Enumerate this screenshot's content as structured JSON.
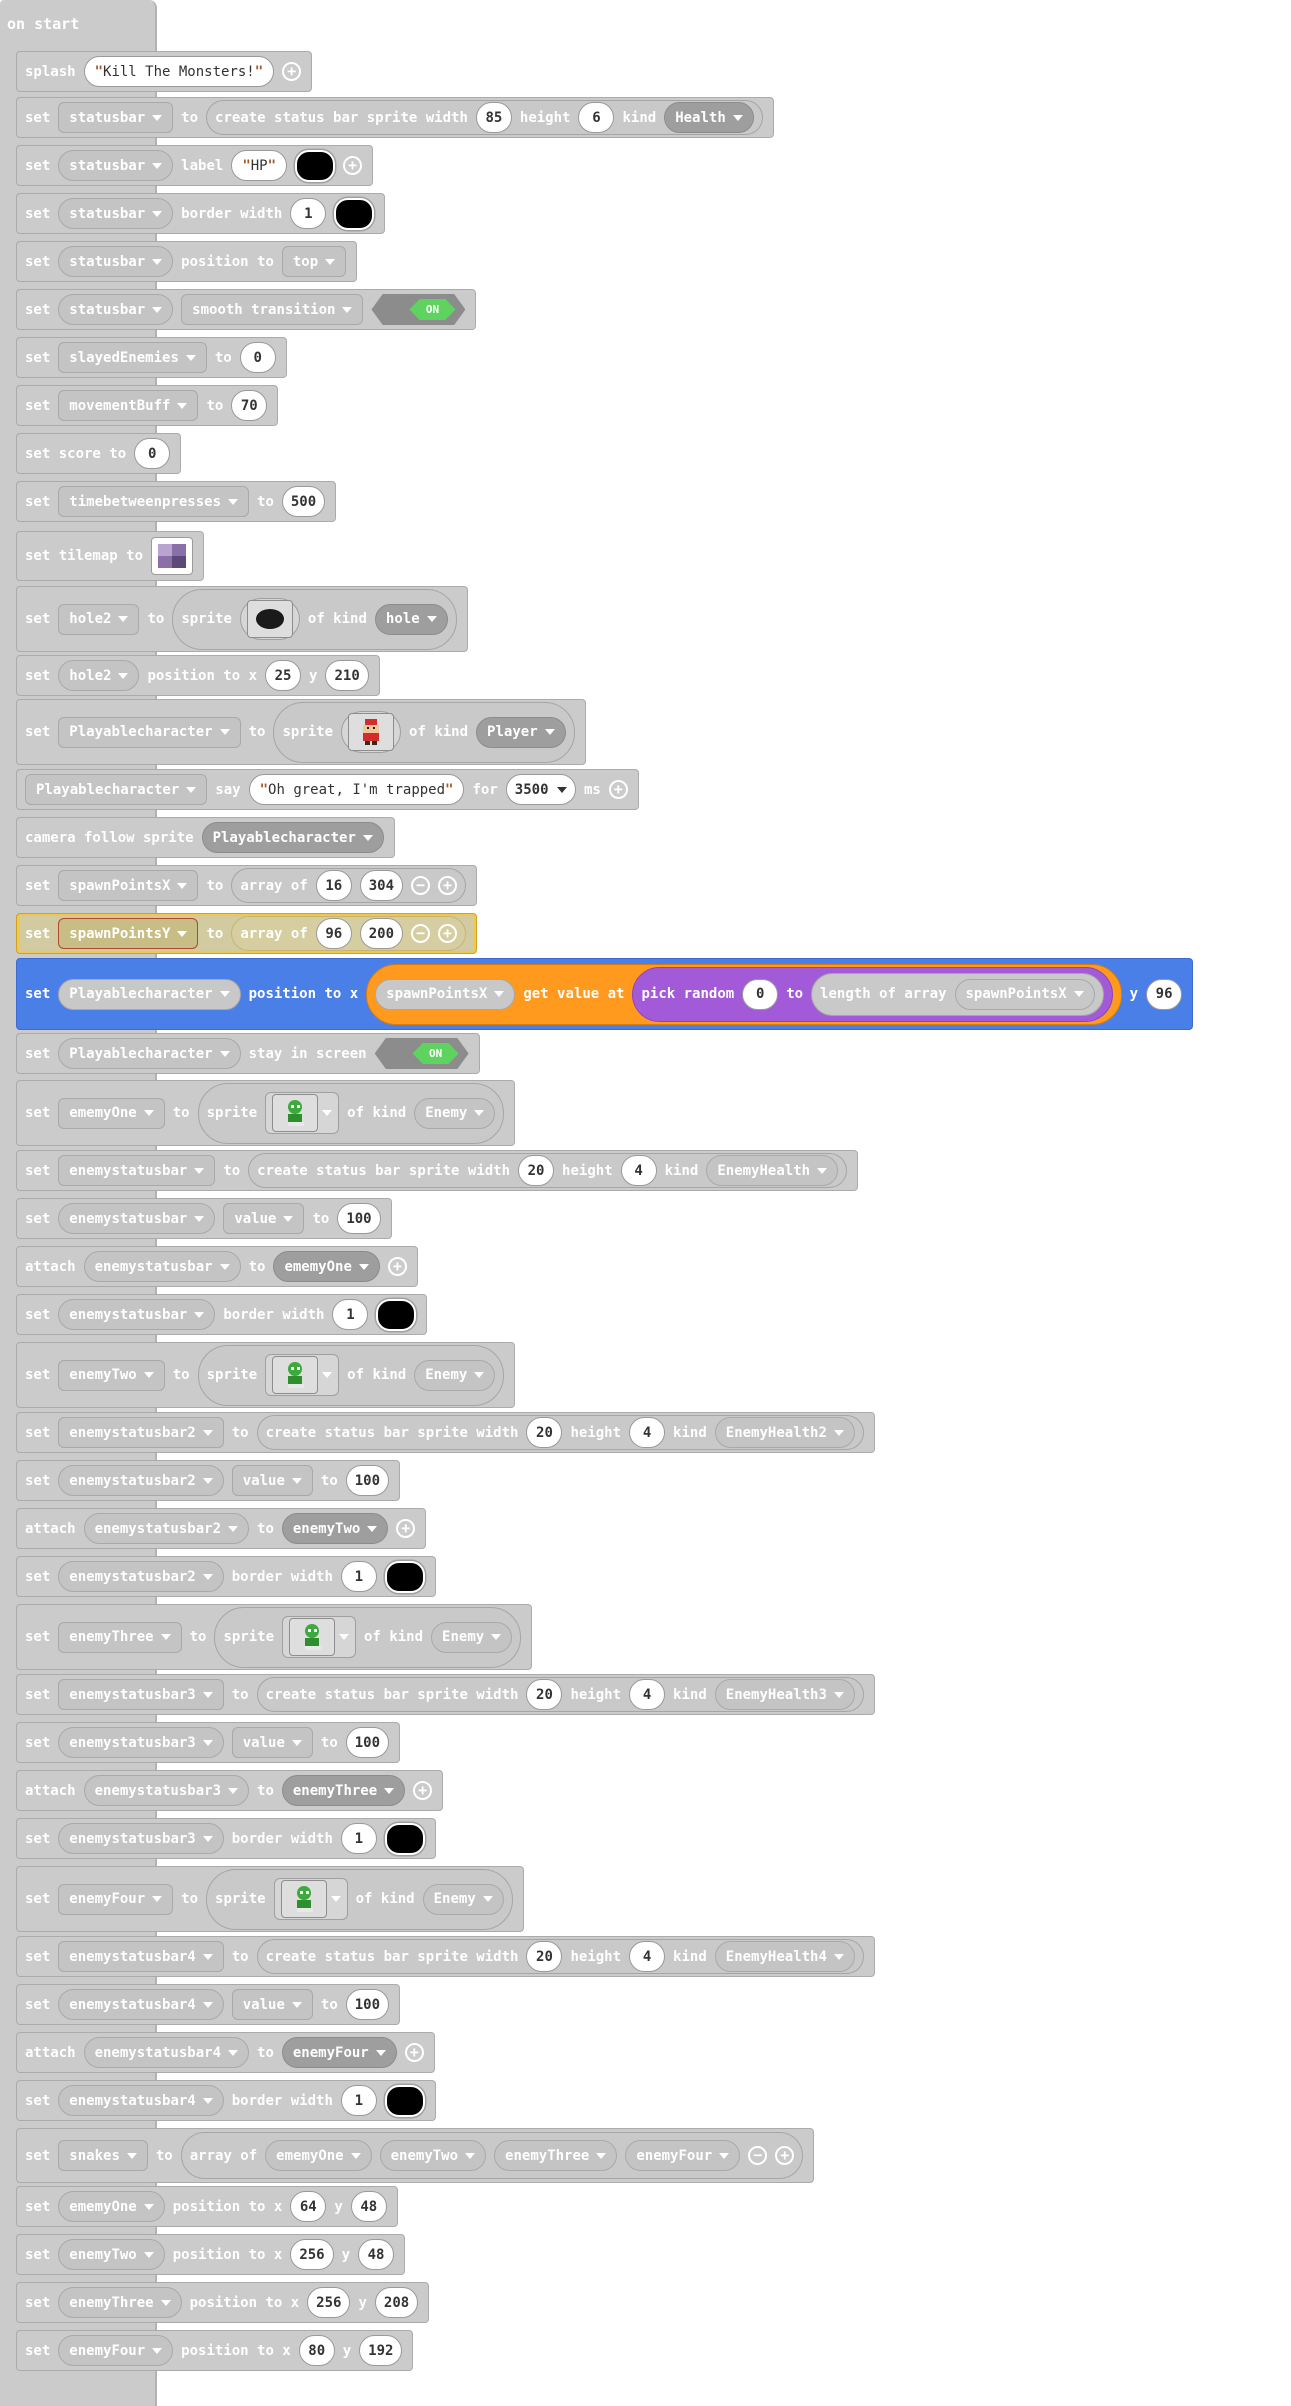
{
  "hat": "on start",
  "kw": {
    "set": "set",
    "to": "to",
    "splash": "splash",
    "label": "label",
    "border_width": "border width",
    "position_to": "position to",
    "of_kind": "of kind",
    "sprite": "sprite",
    "x": "x",
    "y": "y",
    "say": "say",
    "for": "for",
    "ms": "ms",
    "camera_follow": "camera follow sprite",
    "array_of": "array of",
    "get_value_at": "get value at",
    "pick_random": "pick random",
    "length_of_array": "length of array",
    "stay_in_screen": "stay in screen",
    "create_status": "create status bar sprite width",
    "height": "height",
    "kind": "kind",
    "attach": "attach",
    "set_score": "set score to",
    "set_tilemap": "set tilemap to",
    "position_to_x": "position to x",
    "on": "ON"
  },
  "vars": {
    "statusbar": "statusbar",
    "slayedEnemies": "slayedEnemies",
    "movementBuff": "movementBuff",
    "timebetweenpresses": "timebetweenpresses",
    "hole2": "hole2",
    "playable": "Playablecharacter",
    "spawnX": "spawnPointsX",
    "spawnY": "spawnPointsY",
    "emeyOne": "ememyOne",
    "enemyTwo": "enemyTwo",
    "enemyThree": "enemyThree",
    "enemyFour": "enemyFour",
    "esb": "enemystatusbar",
    "esb2": "enemystatusbar2",
    "esb3": "enemystatusbar3",
    "esb4": "enemystatusbar4",
    "snakes": "snakes"
  },
  "kinds": {
    "health": "Health",
    "hole": "hole",
    "player": "Player",
    "enemy": "Enemy",
    "eh": "EnemyHealth",
    "eh2": "EnemyHealth2",
    "eh3": "EnemyHealth3",
    "eh4": "EnemyHealth4"
  },
  "props": {
    "smooth": "smooth transition",
    "top": "top",
    "value": "value"
  },
  "strings": {
    "splash": "Kill The Monsters!",
    "hp": "HP",
    "say": "Oh great, I'm trapped",
    "quote_open": "\"",
    "quote_close": "\""
  },
  "nums": {
    "w85": "85",
    "h6": "6",
    "bw1": "1",
    "zero": "0",
    "mb": "70",
    "tbp": "500",
    "h2x": "25",
    "h2y": "210",
    "say_ms": "3500",
    "sx1": "16",
    "sx2": "304",
    "sy1": "96",
    "sy2": "200",
    "rnd0": "0",
    "y96": "96",
    "w20": "20",
    "h4": "4",
    "v100": "100",
    "e1x": "64",
    "e1y": "48",
    "e2x": "256",
    "e2y": "48",
    "e3x": "256",
    "e3y": "208",
    "e4x": "80",
    "e4y": "192"
  },
  "colors": {
    "block": "#cbcbcb",
    "blue": "#4b7fe8",
    "orange": "#ff9a1f",
    "purple": "#a35ad8",
    "toggle_on": "#5fd35f"
  },
  "icons": {
    "plus": "+",
    "minus": "−"
  }
}
